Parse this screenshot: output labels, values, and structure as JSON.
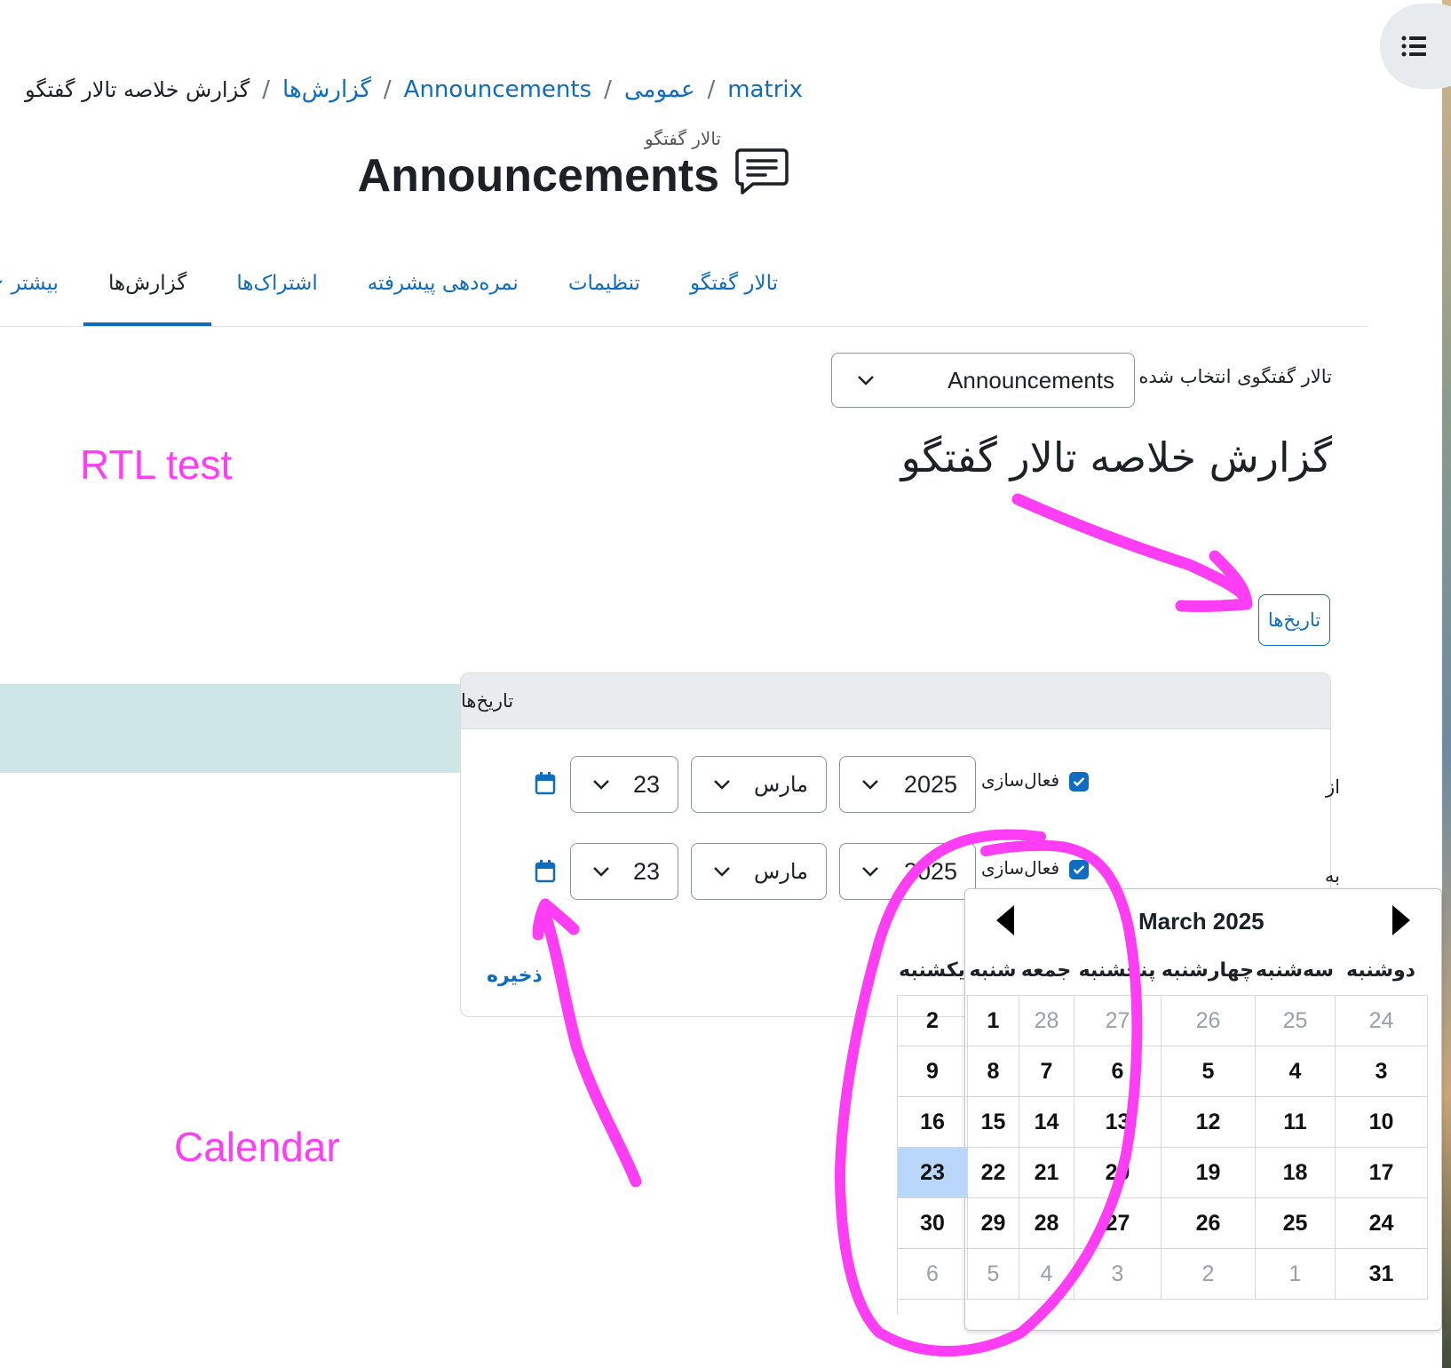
{
  "breadcrumb": {
    "items": [
      "matrix",
      "عمومی",
      "Announcements",
      "گزارش‌ها"
    ],
    "current": "گزارش خلاصه تالار گفتگو",
    "separator": "/"
  },
  "page": {
    "pre_title": "تالار گفتگو",
    "title": "Announcements",
    "title_icon": "forum-icon"
  },
  "tabs": [
    {
      "label": "تالار گفتگو",
      "active": false
    },
    {
      "label": "تنظیمات",
      "active": false
    },
    {
      "label": "نمره‌دهی پیشرفته",
      "active": false
    },
    {
      "label": "اشتراک‌ها",
      "active": false
    },
    {
      "label": "گزارش‌ها",
      "active": true
    },
    {
      "label": "بیشتر",
      "active": false
    }
  ],
  "forum_select": {
    "label": "تالار گفتگوی انتخاب شده",
    "value": "Announcements"
  },
  "report": {
    "heading": "گزارش خلاصه تالار گفتگو",
    "dates_button": "تاریخ‌ها"
  },
  "annotations": {
    "rtl_note": "RTL test",
    "calendar_note": "Calendar",
    "color": "#ff3df4"
  },
  "dates_card": {
    "header": "تاریخ‌ها",
    "from": {
      "label": "از",
      "enable_label": "فعال‌سازی",
      "enabled": true,
      "year": "2025",
      "month": "مارس",
      "day": "23"
    },
    "to": {
      "label": "به",
      "enable_label": "فعال‌سازی",
      "enabled": true,
      "year": "2025",
      "month": "مارس",
      "day": "23"
    },
    "save_label": "ذخیره"
  },
  "calendar": {
    "title": "March 2025",
    "weekdays": [
      "دوشنبه",
      "سه‌شنبه",
      "چهارشنبه",
      "پنجشنبه",
      "جمعه",
      "شنبه",
      "یکشنبه"
    ],
    "weeks": [
      [
        "24",
        "25",
        "26",
        "27",
        "28",
        "1",
        "2"
      ],
      [
        "3",
        "4",
        "5",
        "6",
        "7",
        "8",
        "9"
      ],
      [
        "10",
        "11",
        "12",
        "13",
        "14",
        "15",
        "16"
      ],
      [
        "17",
        "18",
        "19",
        "20",
        "21",
        "22",
        "23"
      ],
      [
        "24",
        "25",
        "26",
        "27",
        "28",
        "29",
        "30"
      ],
      [
        "31",
        "1",
        "2",
        "3",
        "4",
        "5",
        "6"
      ]
    ],
    "selected_day": "23",
    "selected_color": "#b9d7fb"
  },
  "theme": {
    "link_color": "#0f6cbf",
    "teal_bar_color": "#cfe6e8"
  }
}
